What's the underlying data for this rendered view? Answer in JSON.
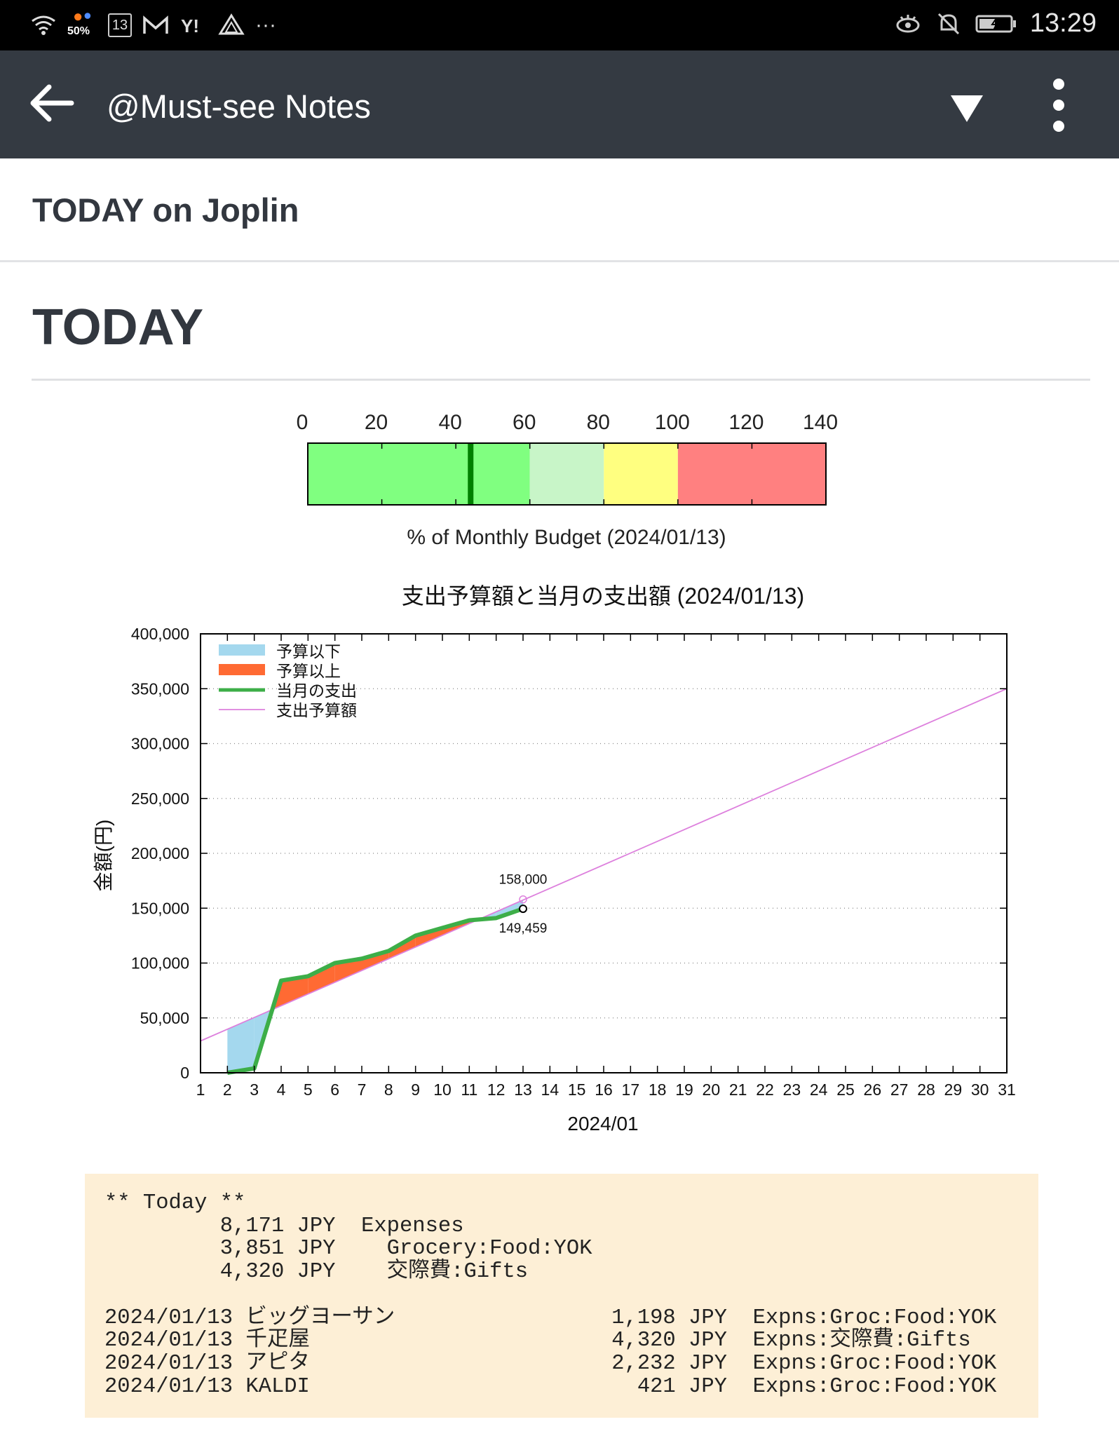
{
  "status_bar": {
    "battery_percent": "50%",
    "calendar_day": "13",
    "time": "13:29",
    "more": "···"
  },
  "app_bar": {
    "title": "@Must-see Notes"
  },
  "note": {
    "title": "TODAY on Joplin",
    "heading": "TODAY"
  },
  "budget_gauge": {
    "ticks": [
      "0",
      "20",
      "40",
      "60",
      "80",
      "100",
      "120",
      "140"
    ],
    "value_percent": 44,
    "bands": [
      {
        "from": 0,
        "to": 60,
        "color": "#80ff80"
      },
      {
        "from": 60,
        "to": 80,
        "color": "#c8f5c8"
      },
      {
        "from": 80,
        "to": 100,
        "color": "#ffff80"
      },
      {
        "from": 100,
        "to": 140,
        "color": "#ff8080"
      }
    ],
    "marker_color": "#008000",
    "label": "% of Monthly Budget (2024/01/13)"
  },
  "chart_data": {
    "type": "line",
    "title": "支出予算額と当月の支出額 (2024/01/13)",
    "xlabel": "2024/01",
    "ylabel": "金額(円)",
    "x_ticks": [
      "1",
      "2",
      "3",
      "4",
      "5",
      "6",
      "7",
      "8",
      "9",
      "10",
      "11",
      "12",
      "13",
      "14",
      "15",
      "16",
      "17",
      "18",
      "19",
      "20",
      "21",
      "22",
      "23",
      "24",
      "25",
      "26",
      "27",
      "28",
      "29",
      "30",
      "31"
    ],
    "y_ticks": [
      "0",
      "50,000",
      "100,000",
      "150,000",
      "200,000",
      "250,000",
      "300,000",
      "350,000",
      "400,000"
    ],
    "xlim": [
      1,
      31
    ],
    "ylim": [
      0,
      400000
    ],
    "legend_position": "top-left",
    "legend": [
      {
        "label": "予算以下",
        "color": "#a4d8ee",
        "kind": "fill"
      },
      {
        "label": "予算以上",
        "color": "#ff6a33",
        "kind": "fill"
      },
      {
        "label": "当月の支出",
        "color": "#3dae48",
        "kind": "line"
      },
      {
        "label": "支出予算額",
        "color": "#dd80dd",
        "kind": "thin-line"
      }
    ],
    "series": [
      {
        "name": "支出予算額",
        "color": "#dd80dd",
        "x": [
          1,
          31
        ],
        "y": [
          29000,
          350000
        ]
      },
      {
        "name": "当月の支出",
        "color": "#3dae48",
        "x": [
          2,
          3,
          4,
          5,
          6,
          7,
          8,
          9,
          10,
          11,
          12,
          13
        ],
        "y": [
          0,
          4000,
          84000,
          88000,
          100000,
          104000,
          111000,
          125000,
          132000,
          139000,
          141000,
          149459
        ]
      }
    ],
    "annotations": [
      {
        "text": "158,000",
        "x": 13,
        "y": 158000
      },
      {
        "text": "149,459",
        "x": 13,
        "y": 149459
      }
    ],
    "grid": "horizontal dotted"
  },
  "ledger": {
    "header": "** Today **",
    "summary": [
      {
        "amount": "8,171 JPY",
        "account": "Expenses"
      },
      {
        "amount": "3,851 JPY",
        "account": "  Grocery:Food:YOK"
      },
      {
        "amount": "4,320 JPY",
        "account": "  交際費:Gifts"
      }
    ],
    "entries": [
      {
        "date": "2024/01/13",
        "payee": "ビッグヨーサン",
        "amount": "1,198 JPY",
        "account": "Expns:Groc:Food:YOK"
      },
      {
        "date": "2024/01/13",
        "payee": "千疋屋",
        "amount": "4,320 JPY",
        "account": "Expns:交際費:Gifts"
      },
      {
        "date": "2024/01/13",
        "payee": "アピタ",
        "amount": "2,232 JPY",
        "account": "Expns:Groc:Food:YOK"
      },
      {
        "date": "2024/01/13",
        "payee": "KALDI",
        "amount": "421 JPY",
        "account": "Expns:Groc:Food:YOK"
      }
    ]
  }
}
